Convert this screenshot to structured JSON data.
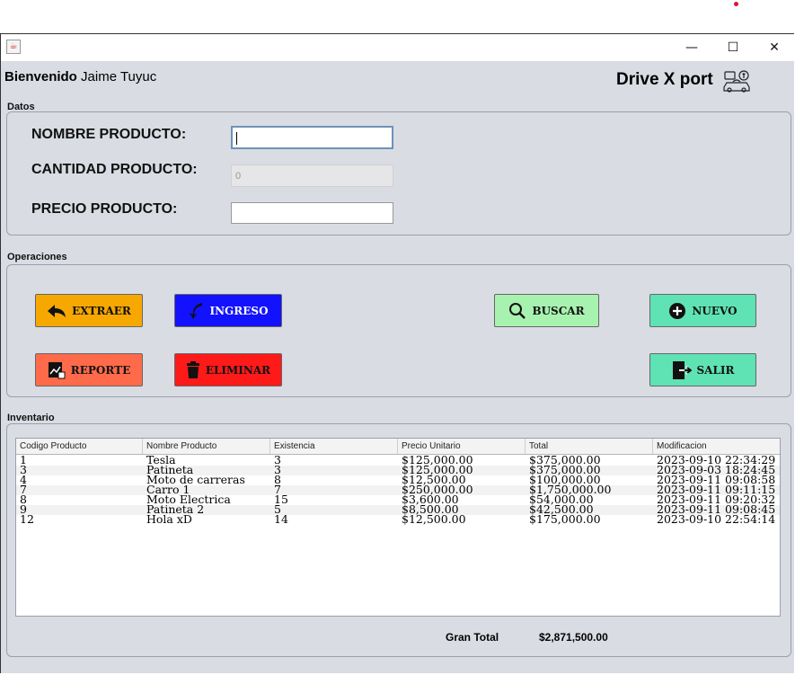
{
  "window": {
    "controls": {
      "minimize": "—",
      "maximize": "☐",
      "close": "✕"
    }
  },
  "header": {
    "welcome_bold": "Bienvenido",
    "welcome_user": "Jaime Tuyuc",
    "brand": "Drive X port",
    "brand_icon": "car-exchange-icon"
  },
  "datos": {
    "title": "Datos",
    "nombre_label": "NOMBRE PRODUCTO:",
    "nombre_value": "",
    "cantidad_label": "CANTIDAD PRODUCTO:",
    "cantidad_value": "0",
    "precio_label": "PRECIO PRODUCTO:",
    "precio_value": ""
  },
  "operaciones": {
    "title": "Operaciones",
    "buttons": {
      "extraer": "EXTRAER",
      "ingreso": "INGRESO",
      "buscar": "BUSCAR",
      "nuevo": "NUEVO",
      "reporte": "REPORTE",
      "eliminar": "ELIMINAR",
      "salir": "SALIR"
    },
    "colors": {
      "extraer": "#f7a800",
      "ingreso": "#1212ff",
      "buscar": "#a8f2b0",
      "nuevo": "#5fe3b4",
      "reporte": "#ff6a4a",
      "eliminar": "#ff1a1a",
      "salir": "#5fe3b4"
    }
  },
  "inventario": {
    "title": "Inventario",
    "columns": [
      "Codigo Producto",
      "Nombre Producto",
      "Existencia",
      "Precio Unitario",
      "Total",
      "Modificacion"
    ],
    "rows": [
      [
        "1",
        "Tesla",
        "3",
        "$125,000.00",
        "$375,000.00",
        "2023-09-10 22:34:29"
      ],
      [
        "3",
        "Patineta",
        "3",
        "$125,000.00",
        "$375,000.00",
        "2023-09-03 18:24:45"
      ],
      [
        "4",
        "Moto de carreras",
        "8",
        "$12,500.00",
        "$100,000.00",
        "2023-09-11 09:08:58"
      ],
      [
        "7",
        "Carro 1",
        "7",
        "$250,000.00",
        "$1,750,000.00",
        "2023-09-11 09:11:15"
      ],
      [
        "8",
        "Moto Electrica",
        "15",
        "$3,600.00",
        "$54,000.00",
        "2023-09-11 09:20:32"
      ],
      [
        "9",
        "Patineta 2",
        "5",
        "$8,500.00",
        "$42,500.00",
        "2023-09-11 09:08:45"
      ],
      [
        "12",
        "Hola xD",
        "14",
        "$12,500.00",
        "$175,000.00",
        "2023-09-10 22:54:14"
      ]
    ],
    "gran_total_label": "Gran Total",
    "gran_total_value": "$2,871,500.00"
  }
}
